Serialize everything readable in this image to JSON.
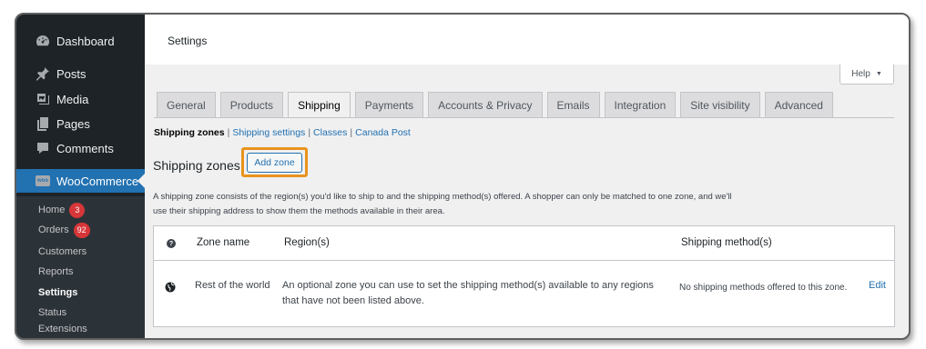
{
  "sidebar": {
    "items": [
      {
        "label": "Dashboard",
        "icon": "dashboard-icon"
      },
      {
        "label": "Posts",
        "icon": "pin-icon"
      },
      {
        "label": "Media",
        "icon": "media-icon"
      },
      {
        "label": "Pages",
        "icon": "pages-icon"
      },
      {
        "label": "Comments",
        "icon": "comment-icon"
      },
      {
        "label": "WooCommerce",
        "icon": "woo-icon",
        "badge_text": "woo"
      }
    ],
    "submenu": [
      {
        "label": "Home",
        "count": "3"
      },
      {
        "label": "Orders",
        "count": "92"
      },
      {
        "label": "Customers"
      },
      {
        "label": "Reports"
      },
      {
        "label": "Settings"
      },
      {
        "label": "Status"
      },
      {
        "label": "Extensions"
      }
    ]
  },
  "header": {
    "title": "Settings"
  },
  "help": {
    "label": "Help",
    "arrow": "▼"
  },
  "tabs": [
    "General",
    "Products",
    "Shipping",
    "Payments",
    "Accounts & Privacy",
    "Emails",
    "Integration",
    "Site visibility",
    "Advanced"
  ],
  "subnav": {
    "current": "Shipping zones",
    "links": [
      "Shipping settings",
      "Classes",
      "Canada Post"
    ],
    "separator": "|"
  },
  "zones": {
    "title": "Shipping zones",
    "add_label": "Add zone",
    "description": "A shipping zone consists of the region(s) you'd like to ship to and the shipping method(s) offered. A shopper can only be matched to one zone, and we'll use their shipping address to show them the methods available in their area.",
    "help_glyph": "?",
    "columns": {
      "name": "Zone name",
      "regions": "Region(s)",
      "methods": "Shipping method(s)"
    },
    "row": {
      "name": "Rest of the world",
      "regions": "An optional zone you can use to set the shipping method(s) available to any regions that have not been listed above.",
      "methods": "No shipping methods offered to this zone.",
      "edit": "Edit"
    }
  },
  "colors": {
    "accent": "#2271b1",
    "highlight": "#e8931d",
    "sidebar_bg": "#1d2327",
    "badge": "#d63638"
  }
}
